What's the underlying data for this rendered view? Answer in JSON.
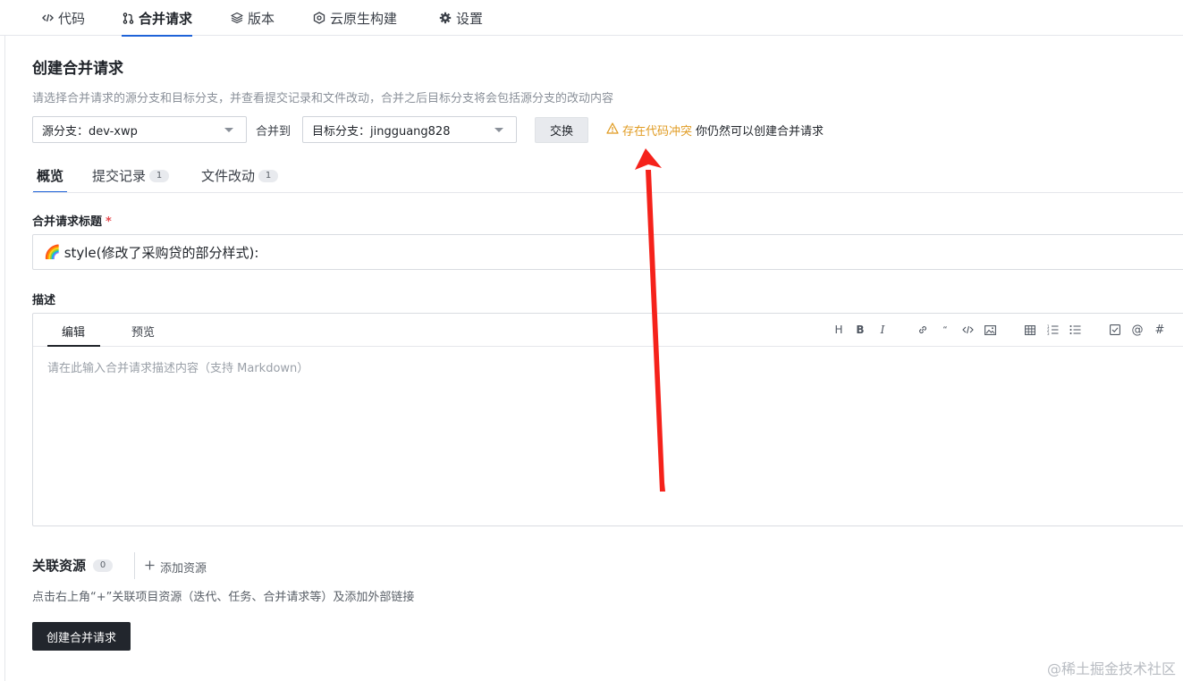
{
  "nav": {
    "items": [
      {
        "label": "代码",
        "icon": "code-icon"
      },
      {
        "label": "合并请求",
        "icon": "merge-request-icon"
      },
      {
        "label": "版本",
        "icon": "layers-icon"
      },
      {
        "label": "云原生构建",
        "icon": "build-icon"
      },
      {
        "label": "设置",
        "icon": "gear-icon"
      }
    ],
    "active": "合并请求"
  },
  "page": {
    "title": "创建合并请求",
    "description": "请选择合并请求的源分支和目标分支，并查看提交记录和文件改动，合并之后目标分支将会包括源分支的改动内容"
  },
  "branches": {
    "source_label": "源分支：dev-xwp",
    "merge_to": "合并到",
    "target_label": "目标分支：jingguang828",
    "swap": "交换",
    "conflict_warning": "存在代码冲突",
    "conflict_note": "你仍然可以创建合并请求"
  },
  "tabs": [
    {
      "label": "概览",
      "count": ""
    },
    {
      "label": "提交记录",
      "count": "1"
    },
    {
      "label": "文件改动",
      "count": "1"
    }
  ],
  "form": {
    "title_label": "合并请求标题",
    "required_mark": "*",
    "title_emoji": "🌈",
    "title_value": "style(修改了采购贷的部分样式):",
    "desc_label": "描述"
  },
  "editor": {
    "tab_edit": "编辑",
    "tab_preview": "预览",
    "placeholder": "请在此输入合并请求描述内容（支持 Markdown）",
    "tools": [
      "H",
      "B",
      "I",
      "link",
      "quote",
      "code",
      "image",
      "table",
      "ordered-list",
      "bullet-list",
      "task",
      "@",
      "#"
    ]
  },
  "resources": {
    "title": "关联资源",
    "count": "0",
    "add": "添加资源",
    "description": "点击右上角“+”关联项目资源（迭代、任务、合并请求等）及添加外部链接"
  },
  "create_button": "创建合并请求",
  "watermark": "@稀土掘金技术社区",
  "colors": {
    "accent": "#1f63d8",
    "warning": "#e09b22",
    "annotation_arrow": "#f5221b",
    "primary_button": "#22262d"
  }
}
